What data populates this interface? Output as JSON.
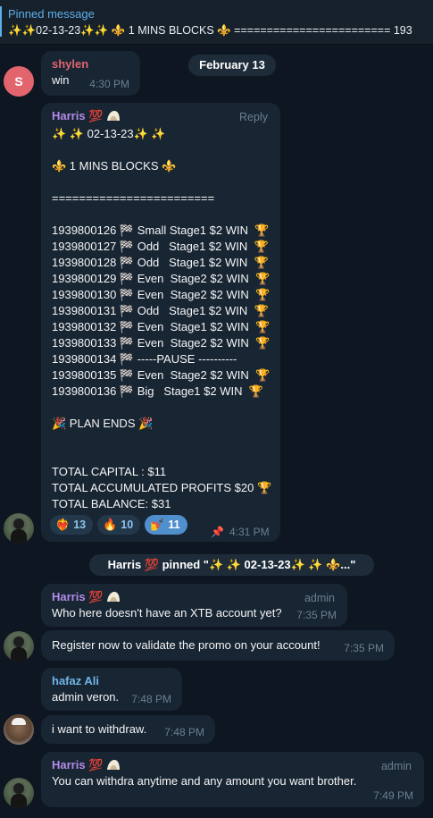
{
  "pinned": {
    "title": "Pinned message",
    "preview": "✨✨02-13-23✨✨   ⚜️ 1 MINS BLOCKS ⚜️  ========================  193"
  },
  "date_badge": "February 13",
  "messages": {
    "shylen": {
      "avatar_letter": "S",
      "sender": "shylen",
      "text": "win",
      "time": "4:30 PM"
    },
    "harris_plan": {
      "sender": "Harris 💯",
      "reply_label": "Reply",
      "lines": [
        "✨ ✨ 02-13-23✨ ✨",
        "",
        "⚜️ 1 MINS BLOCKS ⚜️",
        "",
        "========================",
        "",
        "1939800126 🏁 Small Stage1 $2 WIN  🏆",
        "1939800127 🏁 Odd   Stage1 $2 WIN  🏆",
        "1939800128 🏁 Odd   Stage1 $2 WIN  🏆",
        "1939800129 🏁 Even  Stage2 $2 WIN  🏆",
        "1939800130 🏁 Even  Stage2 $2 WIN  🏆",
        "1939800131 🏁 Odd   Stage1 $2 WIN  🏆",
        "1939800132 🏁 Even  Stage1 $2 WIN  🏆",
        "1939800133 🏁 Even  Stage2 $2 WIN  🏆",
        "1939800134 🏁 -----PAUSE ----------",
        "1939800135 🏁 Even  Stage2 $2 WIN  🏆",
        "1939800136 🏁 Big   Stage1 $2 WIN  🏆",
        "",
        "🎉 PLAN ENDS 🎉",
        "",
        "",
        "TOTAL CAPITAL : $11",
        "TOTAL ACCUMULATED PROFITS $20 🏆",
        "TOTAL BALANCE: $31"
      ],
      "reactions": [
        {
          "emoji": "❤️‍🔥",
          "count": "13"
        },
        {
          "emoji": "🔥",
          "count": "10"
        },
        {
          "emoji": "💅",
          "count": "11"
        }
      ],
      "time": "4:31 PM"
    },
    "pinned_service": "Harris 💯 pinned \"✨ ✨ 02-13-23✨ ✨    ⚜️...\"",
    "harris_xtb": {
      "sender": "Harris 💯",
      "role": "admin",
      "text": "Who here doesn't have an XTB account yet?",
      "time": "7:35 PM"
    },
    "harris_register": {
      "text": "Register now to validate the promo on your account!",
      "time": "7:35 PM"
    },
    "hafaz_1": {
      "sender": "hafaz Ali",
      "text": "admin veron.",
      "time": "7:48 PM"
    },
    "hafaz_2": {
      "text": "i want to withdraw.",
      "time": "7:48 PM"
    },
    "harris_withdraw": {
      "sender": "Harris 💯",
      "role": "admin",
      "text": "You can withdra anytime and any amount you want brother.",
      "time": "7:49 PM"
    }
  },
  "colors": {
    "background": "#0e1621",
    "bubble": "#182533",
    "accent": "#5eaeea",
    "shylen_name": "#e2656e",
    "harris_name": "#b58be8",
    "hafaz_name": "#6fb7e9"
  }
}
